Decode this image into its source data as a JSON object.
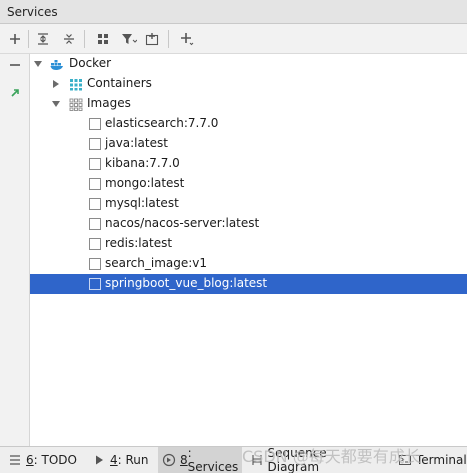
{
  "window": {
    "title": "Services"
  },
  "tree": {
    "root": {
      "label": "Docker"
    },
    "containers": {
      "label": "Containers"
    },
    "images": {
      "label": "Images",
      "items": [
        "elasticsearch:7.7.0",
        "java:latest",
        "kibana:7.7.0",
        "mongo:latest",
        "mysql:latest",
        "nacos/nacos-server:latest",
        "redis:latest",
        "search_image:v1",
        "springboot_vue_blog:latest"
      ],
      "selected_index": 8
    }
  },
  "statusbar": {
    "tabs": [
      {
        "num": "6",
        "label": ": TODO"
      },
      {
        "num": "4",
        "label": ": Run"
      },
      {
        "num": "8",
        "label": ": Services"
      },
      {
        "num": "",
        "label": "Sequence Diagram"
      },
      {
        "num": "",
        "label": "Terminal"
      }
    ]
  },
  "watermark": "CSDN @每天都要有成长",
  "colors": {
    "selection": "#2f65ca",
    "docker_blue": "#2a8fd6",
    "node_teal": "#3ab0c8"
  }
}
